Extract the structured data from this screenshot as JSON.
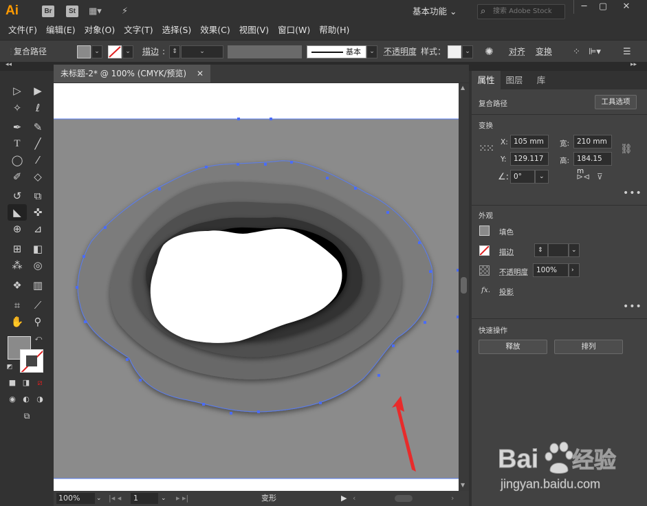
{
  "app": {
    "logo": "Ai",
    "bridge": "Br",
    "stock": "St",
    "workspace": "基本功能",
    "search_placeholder": "搜索 Adobe Stock"
  },
  "menu": [
    "文件(F)",
    "编辑(E)",
    "对象(O)",
    "文字(T)",
    "选择(S)",
    "效果(C)",
    "视图(V)",
    "窗口(W)",
    "帮助(H)"
  ],
  "control": {
    "selection_type": "复合路径",
    "stroke_label": "描边",
    "brush_value": "基本",
    "opacity_label": "不透明度",
    "style_label": "样式",
    "align_label": "对齐",
    "transform_label": "变换"
  },
  "document": {
    "tab_title": "未标题-2* @ 100% (CMYK/预览)",
    "zoom": "100%",
    "page": "1",
    "status": "变形"
  },
  "panel": {
    "tabs": [
      "属性",
      "图层",
      "库"
    ],
    "type_label": "复合路径",
    "tool_options_button": "工具选项",
    "transform_heading": "变换",
    "x_label": "X:",
    "x_value": "105 mm",
    "y_label": "Y:",
    "y_value": "129.117",
    "w_label": "宽:",
    "w_value": "210 mm",
    "h_label": "高:",
    "h_value": "184.15 m",
    "angle_value": "0°",
    "appearance_heading": "外观",
    "fill_label": "填色",
    "stroke_label": "描边",
    "opacity_label": "不透明度",
    "opacity_value": "100%",
    "effect_label": "投影",
    "quick_actions_heading": "快速操作",
    "release_button": "释放",
    "arrange_button": "排列"
  },
  "watermark": {
    "brand": "Bai",
    "brand_cn": "经验",
    "url": "jingyan.baidu.com"
  },
  "colors": {
    "accent_orange": "#ff9a00",
    "canvas_gray": "#8a8a8a",
    "selection_blue": "#4a6cf7",
    "arrow_red": "#e82b2b"
  }
}
